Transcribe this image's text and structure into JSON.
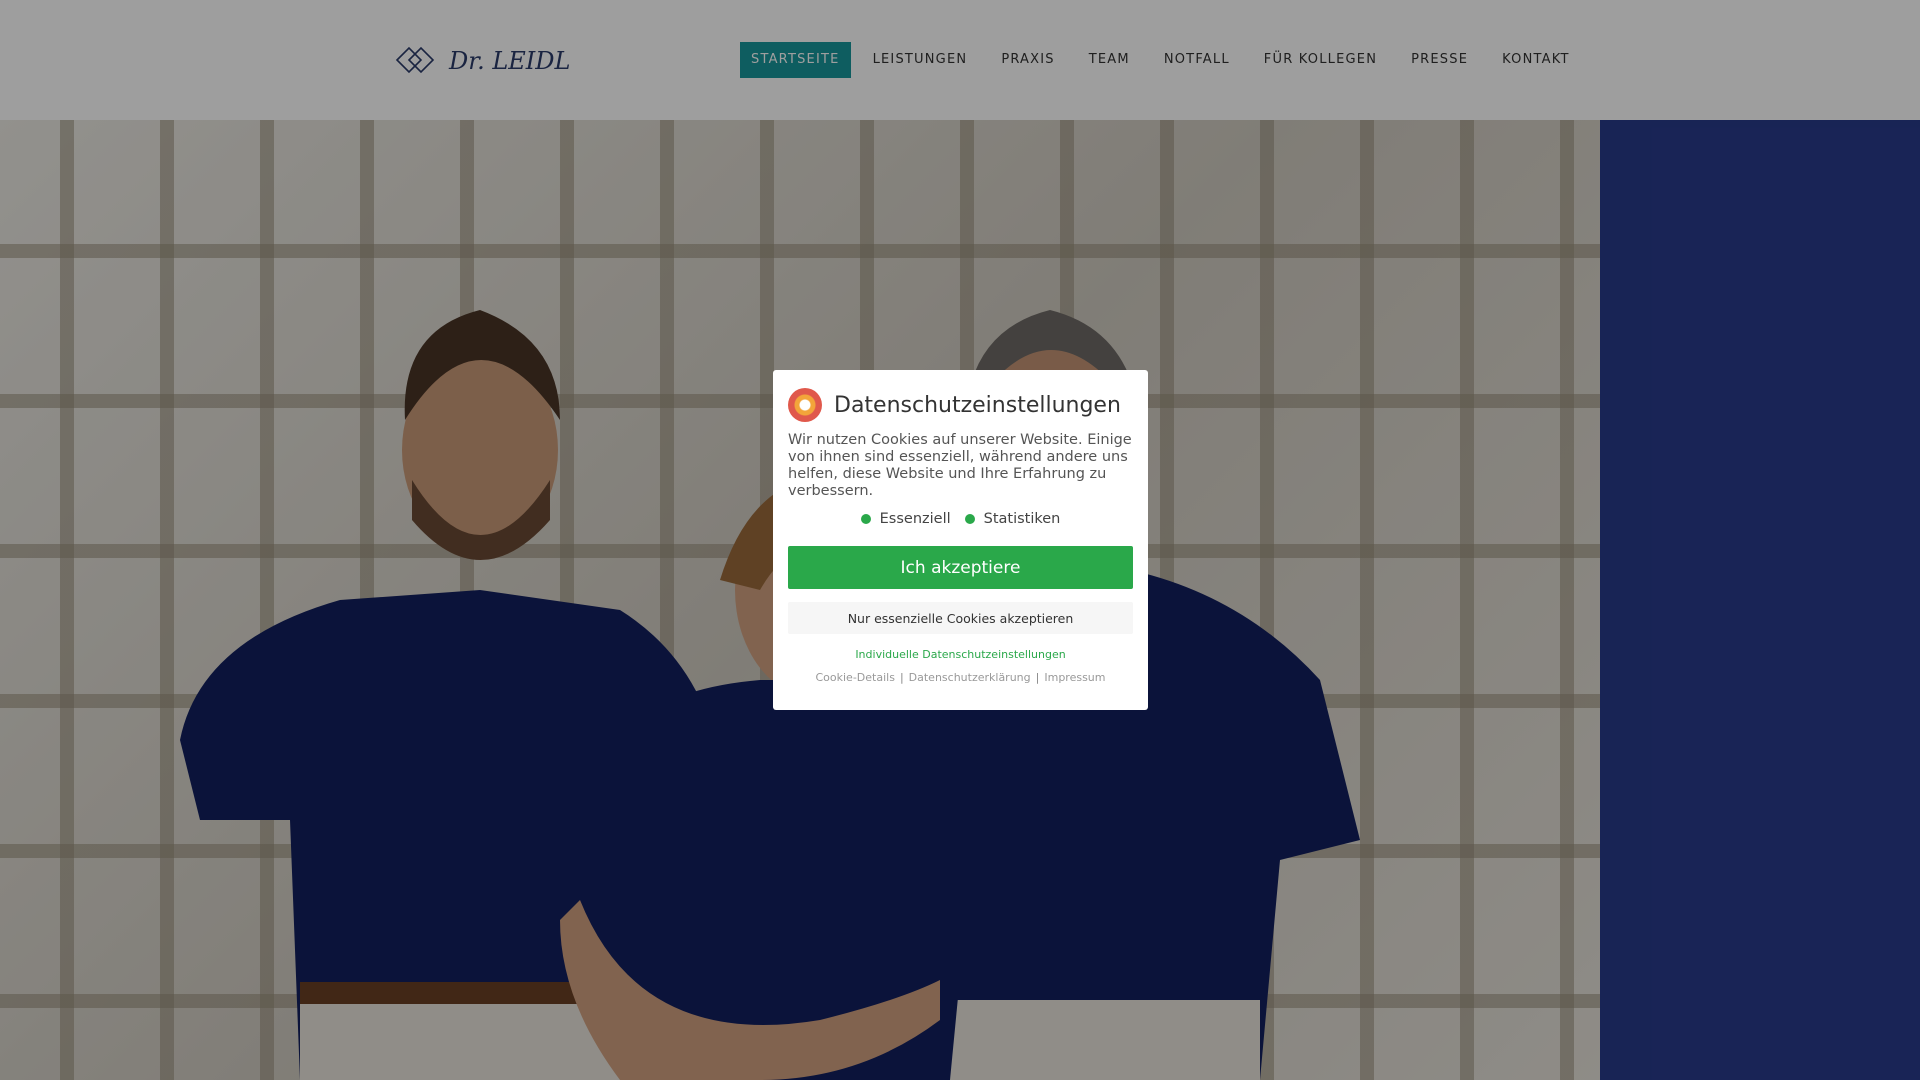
{
  "header": {
    "logo_text": "Dr. LEIDL",
    "nav": [
      {
        "label": "STARTSEITE",
        "active": true
      },
      {
        "label": "LEISTUNGEN"
      },
      {
        "label": "PRAXIS"
      },
      {
        "label": "TEAM"
      },
      {
        "label": "NOTFALL"
      },
      {
        "label": "FÜR KOLLEGEN"
      },
      {
        "label": "PRESSE"
      },
      {
        "label": "KONTAKT"
      }
    ]
  },
  "colors": {
    "accent": "#18979b",
    "side_panel": "#283a8a",
    "accept_green": "#2aa84a"
  },
  "cookie_modal": {
    "title": "Datenschutzeinstellungen",
    "text": "Wir nutzen Cookies auf unserer Website. Einige von ihnen sind essenziell, während andere uns helfen, diese Website und Ihre Erfahrung zu verbessern.",
    "checks": [
      "Essenziell",
      "Statistiken"
    ],
    "accept_label": "Ich akzeptiere",
    "essential_label": "Nur essenzielle Cookies akzeptieren",
    "individual_label": "Individuelle Datenschutzeinstellungen",
    "footer_links": [
      "Cookie-Details",
      "Datenschutzerklärung",
      "Impressum"
    ]
  }
}
